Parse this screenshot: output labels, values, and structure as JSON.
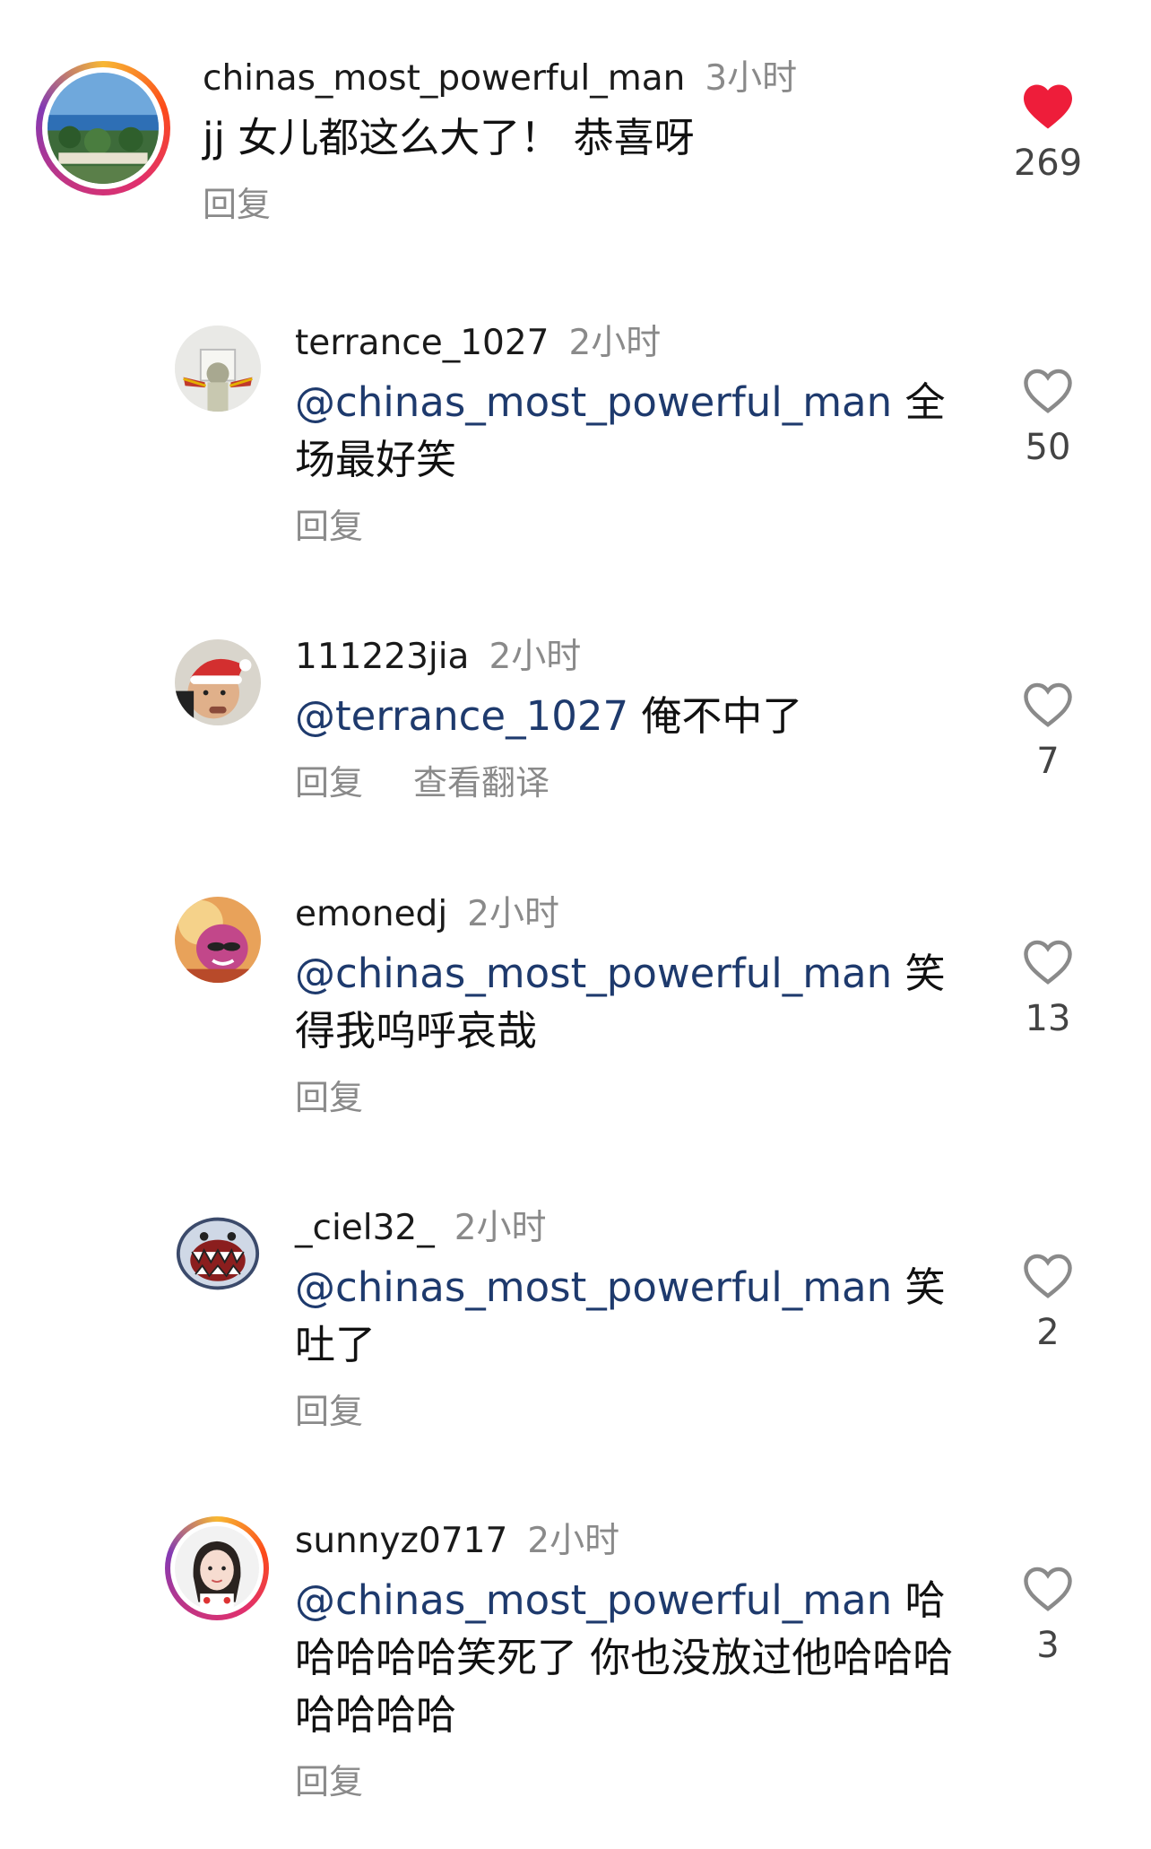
{
  "colors": {
    "mention": "#1e3a6d",
    "like_active": "#ee1d3a",
    "like_outline": "#8a8a8a",
    "muted_text": "#8a8a8a"
  },
  "comments": [
    {
      "username": "chinas_most_powerful_man",
      "time": "3小时",
      "mention": "",
      "text": "jj 女儿都这么大了！  恭喜呀",
      "actions": [
        "回复"
      ],
      "likes": "269",
      "liked": true,
      "avatar_icon": "seaside-avatar-icon"
    },
    {
      "username": "terrance_1027",
      "time": "2小时",
      "mention": "@chinas_most_powerful_man",
      "text": " 全场最好笑",
      "actions": [
        "回复"
      ],
      "likes": "50",
      "liked": false,
      "avatar_icon": "person-arms-up-avatar-icon"
    },
    {
      "username": "111223jia",
      "time": "2小时",
      "mention": "@terrance_1027",
      "text": " 俺不中了",
      "actions": [
        "回复",
        "查看翻译"
      ],
      "likes": "7",
      "liked": false,
      "avatar_icon": "santa-hat-avatar-icon"
    },
    {
      "username": "emonedj",
      "time": "2小时",
      "mention": "@chinas_most_powerful_man",
      "text": " 笑得我呜呼哀哉",
      "actions": [
        "回复"
      ],
      "likes": "13",
      "liked": false,
      "avatar_icon": "cartoon-character-avatar-icon"
    },
    {
      "username": "_ciel32_",
      "time": "2小时",
      "mention": "@chinas_most_powerful_man",
      "text": " 笑吐了",
      "actions": [
        "回复"
      ],
      "likes": "2",
      "liked": false,
      "avatar_icon": "cartoon-shark-avatar-icon"
    },
    {
      "username": "sunnyz0717",
      "time": "2小时",
      "mention": "@chinas_most_powerful_man",
      "text": " 哈哈哈哈哈笑死了 你也没放过他哈哈哈哈哈哈哈",
      "actions": [
        "回复"
      ],
      "likes": "3",
      "liked": false,
      "avatar_icon": "girl-portrait-avatar-icon"
    }
  ]
}
